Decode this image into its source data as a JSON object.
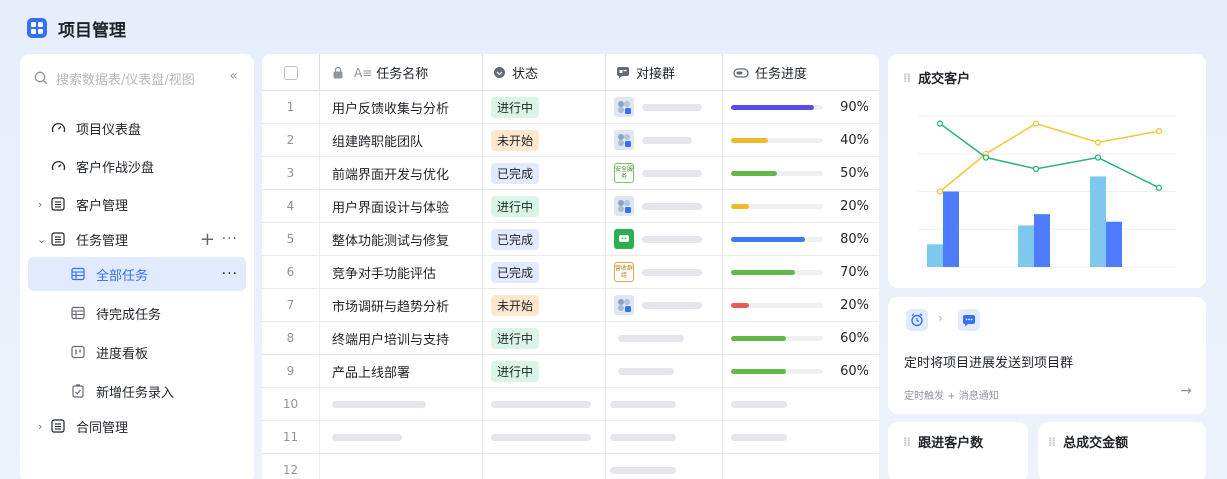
{
  "app": {
    "title": "项目管理"
  },
  "sidebar": {
    "search_placeholder": "搜索数据表/仪表盘/视图",
    "collapse": "«",
    "items": [
      {
        "label": "项目仪表盘",
        "icon": "dashboard-icon"
      },
      {
        "label": "客户作战沙盘",
        "icon": "dashboard-icon"
      },
      {
        "label": "客户管理",
        "icon": "table-icon"
      },
      {
        "label": "任务管理",
        "icon": "table-icon"
      },
      {
        "label": "全部任务",
        "icon": "grid-view-icon"
      },
      {
        "label": "待完成任务",
        "icon": "grid-view-icon"
      },
      {
        "label": "进度看板",
        "icon": "kanban-icon"
      },
      {
        "label": "新增任务录入",
        "icon": "form-icon"
      },
      {
        "label": "合同管理",
        "icon": "table-icon"
      }
    ],
    "add": "+",
    "more": "···"
  },
  "table": {
    "columns": {
      "name": "任务名称",
      "status": "状态",
      "group": "对接群",
      "progress": "任务进度"
    },
    "rows": [
      {
        "idx": "1",
        "name": "用户反馈收集与分析",
        "status": "进行中",
        "progress": 0.9,
        "pct": "90%"
      },
      {
        "idx": "2",
        "name": "组建跨职能团队",
        "status": "未开始",
        "progress": 0.4,
        "pct": "40%"
      },
      {
        "idx": "3",
        "name": "前端界面开发与优化",
        "status": "已完成",
        "progress": 0.5,
        "pct": "50%"
      },
      {
        "idx": "4",
        "name": "用户界面设计与体验",
        "status": "进行中",
        "progress": 0.2,
        "pct": "20%"
      },
      {
        "idx": "5",
        "name": "整体功能测试与修复",
        "status": "已完成",
        "progress": 0.8,
        "pct": "80%"
      },
      {
        "idx": "6",
        "name": "竞争对手功能评估",
        "status": "已完成",
        "progress": 0.7,
        "pct": "70%"
      },
      {
        "idx": "7",
        "name": "市场调研与趋势分析",
        "status": "未开始",
        "progress": 0.2,
        "pct": "20%"
      },
      {
        "idx": "8",
        "name": "终端用户培训与支持",
        "status": "进行中",
        "progress": 0.6,
        "pct": "60%"
      },
      {
        "idx": "9",
        "name": "产品上线部署",
        "status": "进行中",
        "progress": 0.6,
        "pct": "60%"
      }
    ],
    "empty_rows": [
      "10",
      "11",
      "12"
    ],
    "avatar_text": {
      "r3": "安全服务",
      "r6": "营收群组"
    }
  },
  "cards": {
    "chart_title": "成交客户",
    "automation_title": "定时将项目进展发送到项目群",
    "automation_sub": "定时触发 + 消息通知",
    "follow_title": "跟进客户数",
    "amount_title": "总成交金额"
  },
  "colors": {
    "accent": "#3370ff",
    "bar_light": "#7dc8ec",
    "bar_dark": "#4f7bff",
    "line_yellow": "#f5c63a",
    "line_green": "#2db37d"
  },
  "chart_data": {
    "type": "bar",
    "categories": [
      "",
      "",
      ""
    ],
    "series": [
      {
        "values": [
          30,
          55,
          120
        ]
      },
      {
        "values": [
          100,
          70,
          60
        ]
      }
    ],
    "lines": [
      {
        "values": [
          100,
          150,
          190,
          165,
          180
        ]
      },
      {
        "values": [
          190,
          145,
          130,
          145,
          105
        ]
      }
    ],
    "ylim": [
      0,
      200
    ]
  }
}
